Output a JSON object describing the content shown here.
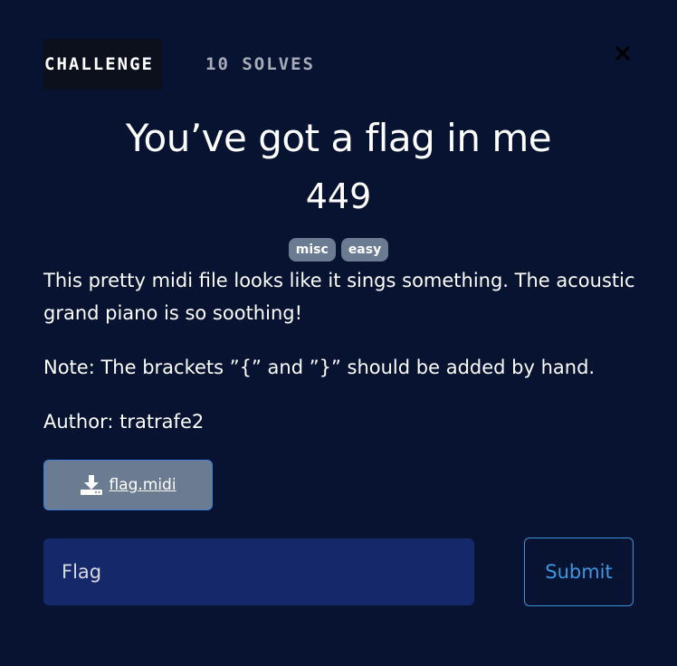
{
  "tabs": {
    "challenge_label": "CHALLENGE",
    "solves_label": "10 SOLVES"
  },
  "close_icon": "close-icon",
  "challenge": {
    "title": "You’ve got a flag in me",
    "points": "449",
    "tags": [
      "misc",
      "easy"
    ],
    "description_lines": [
      "This pretty midi file looks like it sings something. The acoustic grand piano is so soothing!",
      "Note: The brackets ”{” and ”}” should be added by hand.",
      "Author: tratrafe2"
    ]
  },
  "download": {
    "icon": "download-icon",
    "label": "flag.midi"
  },
  "form": {
    "flag_placeholder": "Flag",
    "flag_value": "",
    "submit_label": "Submit"
  },
  "colors": {
    "background": "#081332",
    "tag_bg": "#6b7b92",
    "input_bg": "#152869",
    "accent": "#3a97e0"
  }
}
